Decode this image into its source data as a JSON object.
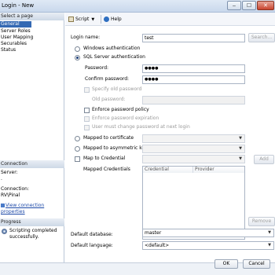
{
  "window": {
    "title": "Login - New",
    "minimize": "‒",
    "maximize": "☐",
    "close": "✕"
  },
  "left": {
    "select_page_header": "Select a page",
    "pages": [
      "General",
      "Server Roles",
      "User Mapping",
      "Securables",
      "Status"
    ],
    "connection_header": "Connection",
    "server_label": "Server:",
    "server_value": ".",
    "connection_label": "Connection:",
    "connection_value": "RV\\Pinal",
    "view_connection_link": "View connection properties",
    "progress_header": "Progress",
    "progress_status": "Scripting completed successfully."
  },
  "toolbar": {
    "script_label": "Script",
    "help_label": "Help"
  },
  "form": {
    "login_name_label": "Login name:",
    "login_name_value": "test",
    "search_button": "Search...",
    "windows_auth": "Windows authentication",
    "sql_auth": "SQL Server authentication",
    "password_label": "Password:",
    "password_value": "●●●●",
    "confirm_password_label": "Confirm password:",
    "confirm_password_value": "●●●●",
    "specify_old_password": "Specify old password",
    "old_password_label": "Old password:",
    "enforce_policy": "Enforce password policy",
    "enforce_expiration": "Enforce password expiration",
    "must_change": "User must change password at next login",
    "mapped_certificate": "Mapped to certificate",
    "mapped_asymmetric_key": "Mapped to asymmetric key",
    "map_credential": "Map to Credential",
    "add_button": "Add",
    "mapped_credentials_label": "Mapped Credentials",
    "col_credential": "Credential",
    "col_provider": "Provider",
    "remove_button": "Remove",
    "default_database_label": "Default database:",
    "default_database_value": "master",
    "default_language_label": "Default language:",
    "default_language_value": "<default>"
  },
  "buttons": {
    "ok": "OK",
    "cancel": "Cancel"
  }
}
